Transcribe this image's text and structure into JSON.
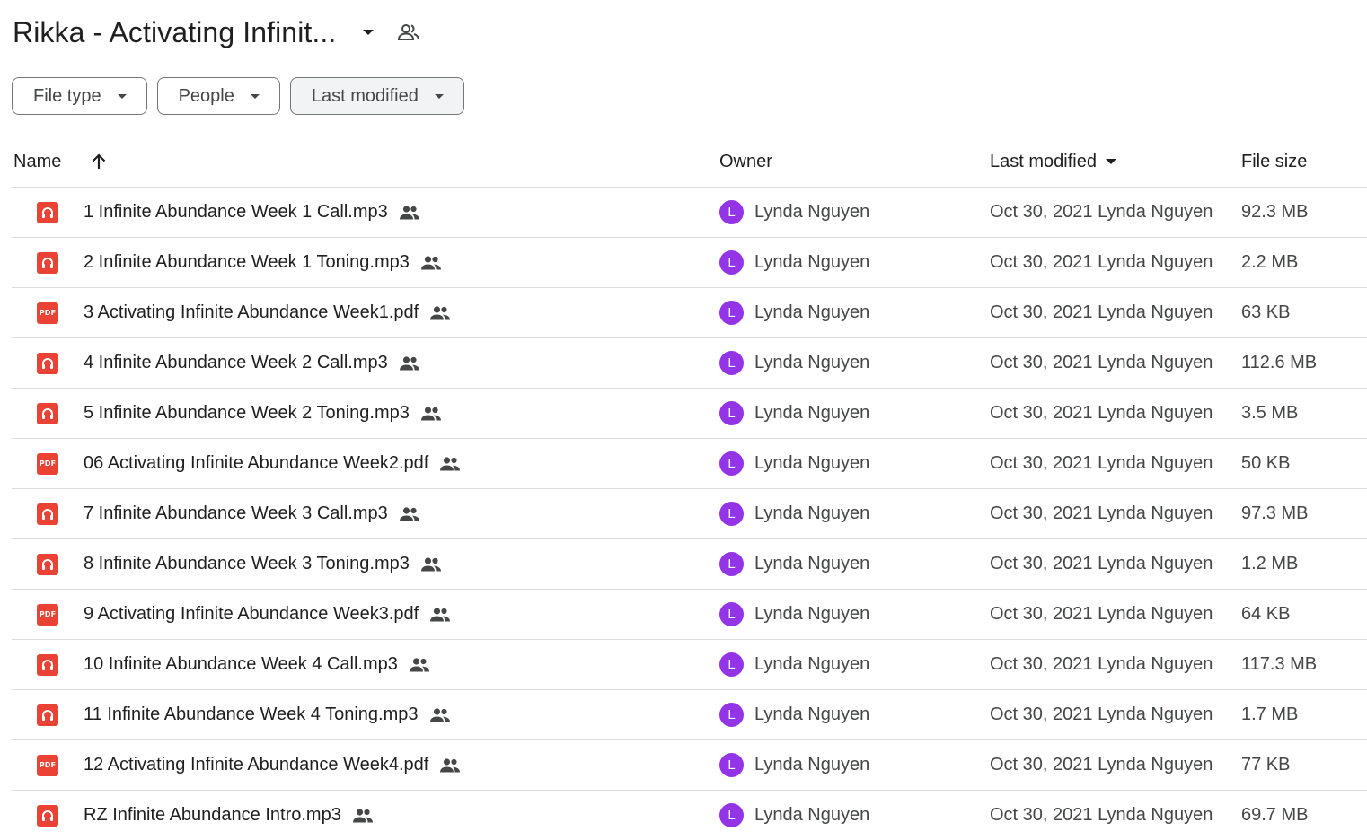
{
  "header": {
    "title": "Rikka - Activating Infinit...",
    "title_caret_icon": "arrow-drop-down-icon",
    "share_icon": "shared-folder-people-icon"
  },
  "filters": [
    {
      "label": "File type",
      "icon": "arrow-drop-down-icon"
    },
    {
      "label": "People",
      "icon": "arrow-drop-down-icon"
    },
    {
      "label": "Last modified",
      "icon": "arrow-drop-down-icon",
      "active": true
    }
  ],
  "columns": {
    "name": "Name",
    "sort_icon": "arrow-upward-icon",
    "owner": "Owner",
    "last_modified": "Last modified",
    "last_modified_icon": "arrow-drop-down-icon",
    "file_size": "File size"
  },
  "files": [
    {
      "name": "1 Infinite Abundance Week 1 Call.mp3",
      "type": "audio",
      "owner": "Lynda Nguyen",
      "avatar": "L",
      "modified": "Oct 30, 2021 Lynda Nguyen",
      "size": "92.3 MB"
    },
    {
      "name": "2 Infinite Abundance Week 1 Toning.mp3",
      "type": "audio",
      "owner": "Lynda Nguyen",
      "avatar": "L",
      "modified": "Oct 30, 2021 Lynda Nguyen",
      "size": "2.2 MB"
    },
    {
      "name": "3 Activating Infinite Abundance Week1.pdf",
      "type": "pdf",
      "owner": "Lynda Nguyen",
      "avatar": "L",
      "modified": "Oct 30, 2021 Lynda Nguyen",
      "size": "63 KB"
    },
    {
      "name": "4 Infinite Abundance Week 2 Call.mp3",
      "type": "audio",
      "owner": "Lynda Nguyen",
      "avatar": "L",
      "modified": "Oct 30, 2021 Lynda Nguyen",
      "size": "112.6 MB"
    },
    {
      "name": "5 Infinite Abundance Week 2 Toning.mp3",
      "type": "audio",
      "owner": "Lynda Nguyen",
      "avatar": "L",
      "modified": "Oct 30, 2021 Lynda Nguyen",
      "size": "3.5 MB"
    },
    {
      "name": "06 Activating Infinite Abundance Week2.pdf",
      "type": "pdf",
      "owner": "Lynda Nguyen",
      "avatar": "L",
      "modified": "Oct 30, 2021 Lynda Nguyen",
      "size": "50 KB"
    },
    {
      "name": "7 Infinite Abundance Week 3 Call.mp3",
      "type": "audio",
      "owner": "Lynda Nguyen",
      "avatar": "L",
      "modified": "Oct 30, 2021 Lynda Nguyen",
      "size": "97.3 MB"
    },
    {
      "name": "8 Infinite Abundance Week 3 Toning.mp3",
      "type": "audio",
      "owner": "Lynda Nguyen",
      "avatar": "L",
      "modified": "Oct 30, 2021 Lynda Nguyen",
      "size": "1.2 MB"
    },
    {
      "name": "9 Activating Infinite Abundance Week3.pdf",
      "type": "pdf",
      "owner": "Lynda Nguyen",
      "avatar": "L",
      "modified": "Oct 30, 2021 Lynda Nguyen",
      "size": "64 KB"
    },
    {
      "name": "10 Infinite Abundance Week 4 Call.mp3",
      "type": "audio",
      "owner": "Lynda Nguyen",
      "avatar": "L",
      "modified": "Oct 30, 2021 Lynda Nguyen",
      "size": "117.3 MB"
    },
    {
      "name": "11 Infinite Abundance Week 4 Toning.mp3",
      "type": "audio",
      "owner": "Lynda Nguyen",
      "avatar": "L",
      "modified": "Oct 30, 2021 Lynda Nguyen",
      "size": "1.7 MB"
    },
    {
      "name": "12 Activating Infinite Abundance Week4.pdf",
      "type": "pdf",
      "owner": "Lynda Nguyen",
      "avatar": "L",
      "modified": "Oct 30, 2021 Lynda Nguyen",
      "size": "77 KB"
    },
    {
      "name": "RZ Infinite Abundance Intro.mp3",
      "type": "audio",
      "owner": "Lynda Nguyen",
      "avatar": "L",
      "modified": "Oct 30, 2021 Lynda Nguyen",
      "size": "69.7 MB"
    }
  ],
  "pdf_icon_text": "PDF",
  "colors": {
    "file_icon": "#ea4335",
    "avatar": "#9334e6",
    "divider": "#dadce0"
  }
}
